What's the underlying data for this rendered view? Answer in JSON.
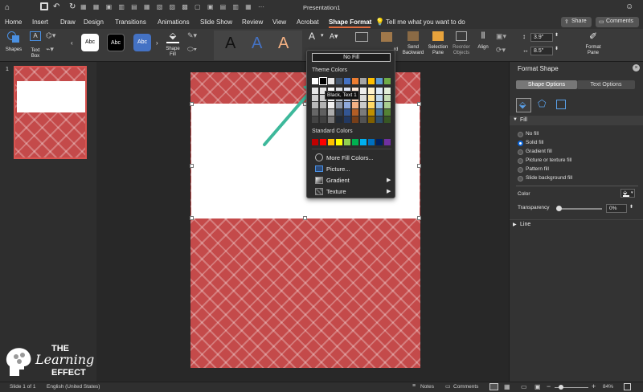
{
  "titlebar": {
    "title": "Presentation1",
    "search": "Tell me what you want to do",
    "share": "Share",
    "comments": "Comments"
  },
  "tabs": [
    "Home",
    "Insert",
    "Draw",
    "Design",
    "Transitions",
    "Animations",
    "Slide Show",
    "Review",
    "View",
    "Acrobat",
    "Shape Format"
  ],
  "ribbon": {
    "shapes": "Shapes",
    "textbox_1": "Text",
    "textbox_2": "Box",
    "style_abc": "Abc",
    "shape_fill_1": "Shape",
    "shape_fill_2": "Fill",
    "wordart": "A",
    "selection_pane_1": "Selection",
    "selection_pane_2": "Pane",
    "reorder_1": "Reorder",
    "reorder_2": "Objects",
    "send_backward_1": "Send",
    "send_backward_2": "Backward",
    "bring_forward_suffix": "rd",
    "align": "Align",
    "height": "3.9\"",
    "width": "8.5\"",
    "format_pane_1": "Format",
    "format_pane_2": "Pane"
  },
  "slides": {
    "number": "1"
  },
  "fill_menu": {
    "no_fill": "No Fill",
    "theme_colors": "Theme Colors",
    "tooltip": "Black, Text 1",
    "standard_colors": "Standard Colors",
    "more_colors": "More Fill Colors...",
    "picture": "Picture...",
    "gradient": "Gradient",
    "texture": "Texture",
    "theme_top": [
      "#ffffff",
      "#000000",
      "#e7e6e6",
      "#44546a",
      "#4472c4",
      "#ed7d31",
      "#a5a5a5",
      "#ffc000",
      "#5b9bd5",
      "#70ad47"
    ],
    "standard": [
      "#c00000",
      "#ff0000",
      "#ffc000",
      "#ffff00",
      "#92d050",
      "#00b050",
      "#00b0f0",
      "#0070c0",
      "#002060",
      "#7030a0"
    ]
  },
  "format_shape": {
    "title": "Format Shape",
    "shape_options": "Shape Options",
    "text_options": "Text Options",
    "fill_section": "Fill",
    "options": [
      "No fill",
      "Solid fill",
      "Gradient fill",
      "Picture or texture fill",
      "Pattern fill",
      "Slide background fill"
    ],
    "selected_index": 1,
    "color_label": "Color",
    "transparency_label": "Transparency",
    "transparency_value": "0%",
    "line_section": "Line"
  },
  "status": {
    "slide": "Slide 1 of 1",
    "language": "English (United States)",
    "notes": "Notes",
    "comments": "Comments",
    "zoom": "84%"
  },
  "watermark": {
    "line1": "THE",
    "line2": "Learning",
    "line3": "EFFECT"
  }
}
